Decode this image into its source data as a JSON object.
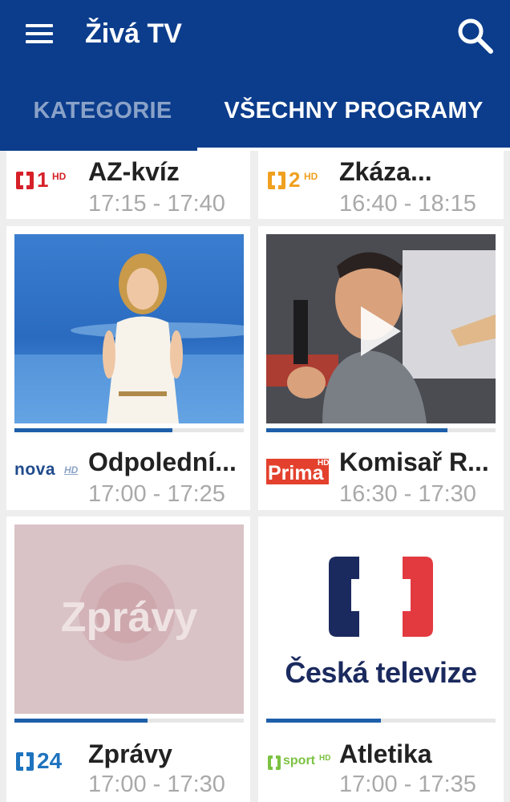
{
  "app": {
    "title": "Živá TV"
  },
  "tabs": {
    "categories": "KATEGORIE",
    "all_programs": "VŠECHNY PROGRAMY",
    "active": "all_programs"
  },
  "cards": [
    {
      "channel": "ČT1 HD",
      "logo_icon": "ct1-hd-logo",
      "logo_num": "1",
      "logo_sub": "HD",
      "title": "AZ-kvíz",
      "time": "17:15 - 17:40"
    },
    {
      "channel": "ČT2 HD",
      "logo_icon": "ct2-hd-logo",
      "logo_num": "2",
      "logo_sub": "HD",
      "title": "Zkáza...",
      "time": "16:40 - 18:15"
    },
    {
      "channel": "Nova HD",
      "logo_icon": "nova-hd-logo",
      "logo_text": "nova",
      "logo_sub": "HD",
      "title": "Odpolední...",
      "time": "17:00 - 17:25",
      "progress": 0.69
    },
    {
      "channel": "Prima HD",
      "logo_icon": "prima-hd-logo",
      "logo_text": "Prima",
      "logo_sub": "HD",
      "title": "Komisař R...",
      "time": "16:30 - 17:30",
      "progress": 0.79
    },
    {
      "channel": "ČT24",
      "logo_icon": "ct24-logo",
      "logo_num": "24",
      "title": "Zprávy",
      "time": "17:00 - 17:30",
      "thumb_text": "Zprávy",
      "progress": 0.58
    },
    {
      "channel": "ČT sport HD",
      "logo_icon": "ct-sport-hd-logo",
      "logo_text": "sport",
      "logo_sub": "HD",
      "title": "Atletika",
      "time": "17:00 - 17:35",
      "thumb_text": "Česká televize",
      "progress": 0.5
    }
  ],
  "colors": {
    "appbar": "#0c3d8c",
    "progress": "#1e5faa",
    "ct_red": "#d62028",
    "ct2_orange": "#f0a020",
    "ct24_blue": "#1e73be",
    "sport_green": "#7cc242",
    "prima_red": "#e3412d"
  }
}
